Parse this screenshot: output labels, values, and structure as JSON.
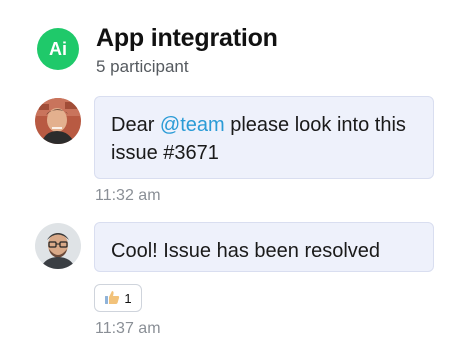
{
  "header": {
    "avatar_initials": "Ai",
    "title": "App integration",
    "subtitle": "5 participant"
  },
  "messages": [
    {
      "text_before": "Dear ",
      "mention": "@team",
      "text_after": " please look into this issue #3671",
      "time": "11:32 am"
    },
    {
      "text": "Cool! Issue has been resolved",
      "time": "11:37 am",
      "reaction": {
        "icon": "thumbs-up-icon",
        "count": "1"
      }
    }
  ],
  "colors": {
    "accent_green": "#1fc96a",
    "bubble_bg": "#eef1fb",
    "mention": "#2a9bd6"
  }
}
